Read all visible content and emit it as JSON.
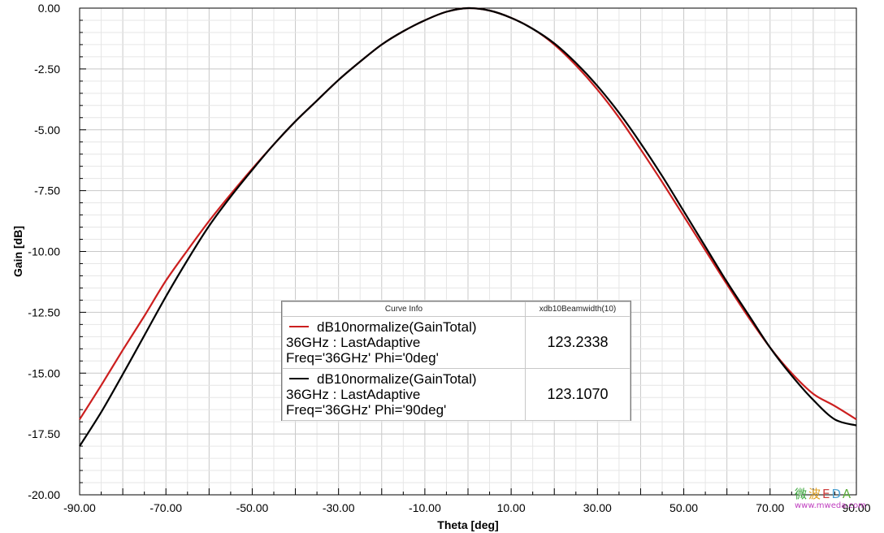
{
  "chart_data": {
    "type": "line",
    "xlabel": "Theta [deg]",
    "ylabel": "Gain [dB]",
    "xlim": [
      -90,
      90
    ],
    "ylim": [
      -20,
      0
    ],
    "x_ticks": [
      "-90.00",
      "-70.00",
      "-50.00",
      "-30.00",
      "-10.00",
      "10.00",
      "30.00",
      "50.00",
      "70.00",
      "90.00"
    ],
    "y_ticks": [
      "0.00",
      "-2.50",
      "-5.00",
      "-7.50",
      "-10.00",
      "-12.50",
      "-15.00",
      "-17.50",
      "-20.00"
    ],
    "grid": true,
    "series": [
      {
        "name": "dB10normalize(GainTotal) 36GHz : LastAdaptive Freq='36GHz' Phi='0deg'",
        "color": "#cc1f1f",
        "x": [
          -90,
          -85,
          -80,
          -75,
          -70,
          -65,
          -60,
          -55,
          -50,
          -45,
          -40,
          -35,
          -30,
          -25,
          -20,
          -15,
          -10,
          -5,
          0,
          5,
          10,
          15,
          20,
          25,
          30,
          35,
          40,
          45,
          50,
          55,
          60,
          65,
          70,
          75,
          80,
          85,
          90
        ],
        "values": [
          -16.9,
          -15.5,
          -14.05,
          -12.65,
          -11.2,
          -9.95,
          -8.75,
          -7.65,
          -6.6,
          -5.6,
          -4.65,
          -3.8,
          -2.95,
          -2.2,
          -1.5,
          -0.95,
          -0.5,
          -0.15,
          0.0,
          -0.1,
          -0.4,
          -0.85,
          -1.5,
          -2.35,
          -3.35,
          -4.5,
          -5.8,
          -7.15,
          -8.55,
          -9.95,
          -11.35,
          -12.7,
          -13.95,
          -15.0,
          -15.85,
          -16.35,
          -16.9
        ]
      },
      {
        "name": "dB10normalize(GainTotal) 36GHz : LastAdaptive Freq='36GHz' Phi='90deg'",
        "color": "#000000",
        "x": [
          -90,
          -85,
          -80,
          -75,
          -70,
          -65,
          -60,
          -55,
          -50,
          -45,
          -40,
          -35,
          -30,
          -25,
          -20,
          -15,
          -10,
          -5,
          0,
          5,
          10,
          15,
          20,
          25,
          30,
          35,
          40,
          45,
          50,
          55,
          60,
          65,
          70,
          75,
          80,
          85,
          90
        ],
        "values": [
          -18.0,
          -16.6,
          -15.05,
          -13.45,
          -11.85,
          -10.35,
          -8.95,
          -7.75,
          -6.65,
          -5.6,
          -4.65,
          -3.8,
          -2.95,
          -2.2,
          -1.5,
          -0.95,
          -0.5,
          -0.15,
          0.0,
          -0.1,
          -0.4,
          -0.85,
          -1.45,
          -2.25,
          -3.2,
          -4.3,
          -5.55,
          -6.9,
          -8.35,
          -9.8,
          -11.25,
          -12.6,
          -13.95,
          -15.1,
          -16.1,
          -16.9,
          -17.15
        ]
      }
    ]
  },
  "legend": {
    "header_info": "Curve Info",
    "header_value": "xdb10Beamwidth(10)",
    "rows": [
      {
        "line1": "dB10normalize(GainTotal)",
        "line2": "36GHz : LastAdaptive",
        "line3": "Freq='36GHz' Phi='0deg'",
        "value": "123.2338",
        "color": "#cc1f1f"
      },
      {
        "line1": "dB10normalize(GainTotal)",
        "line2": "36GHz : LastAdaptive",
        "line3": "Freq='36GHz' Phi='90deg'",
        "value": "123.1070",
        "color": "#000000"
      }
    ]
  },
  "watermark": {
    "text": "微波EDA",
    "url": "www.mweda.com"
  }
}
